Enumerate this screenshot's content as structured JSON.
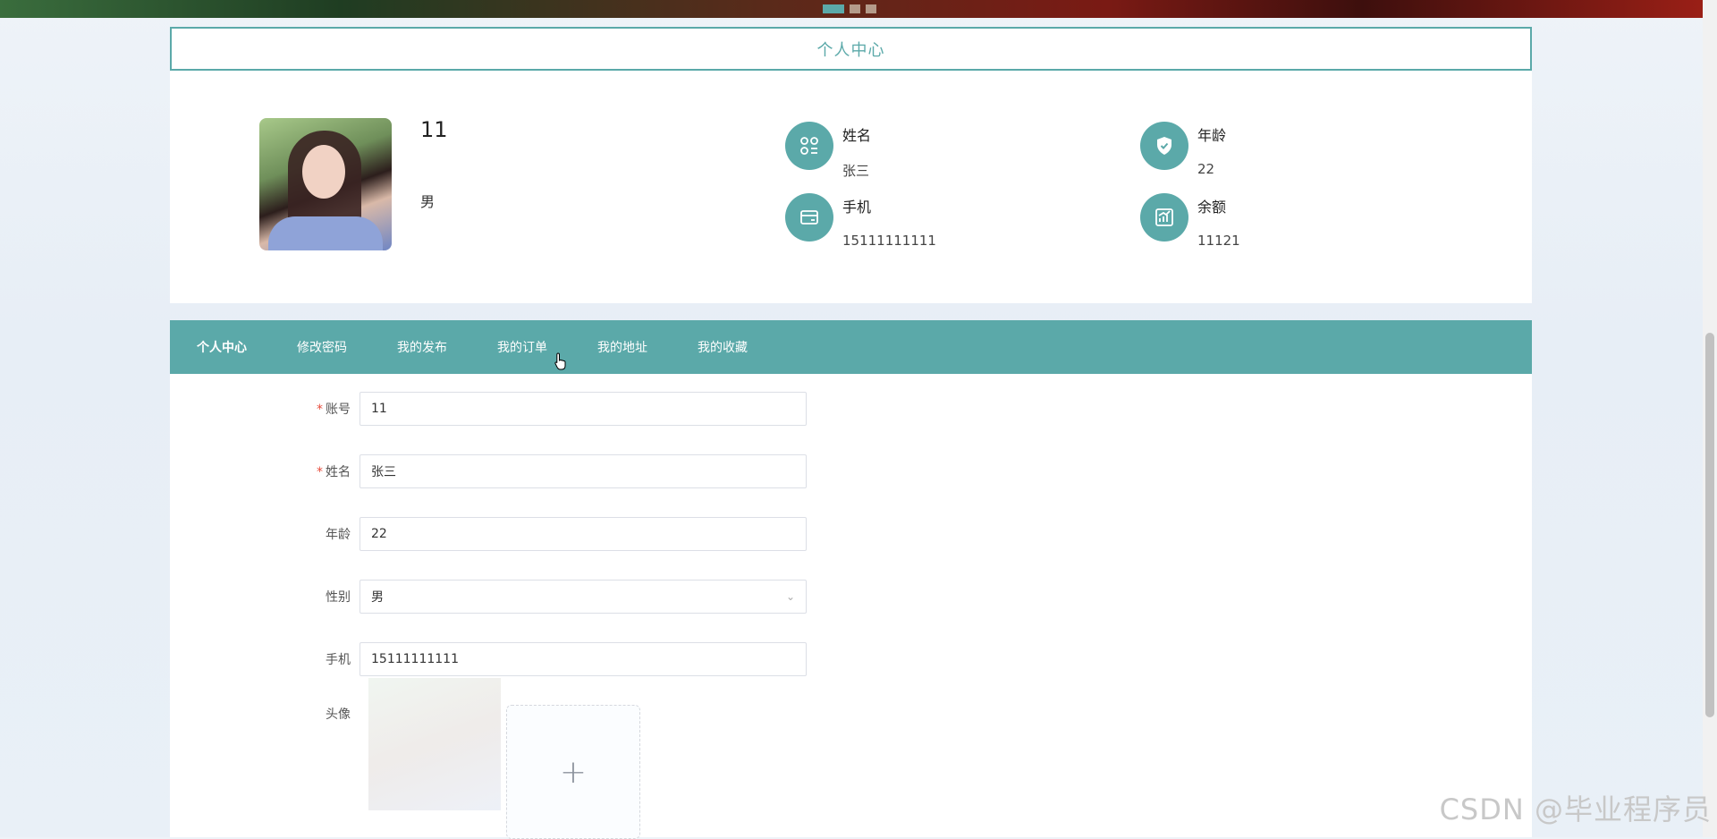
{
  "banner": {
    "slides": 3,
    "active_slide": 1
  },
  "page": {
    "title": "个人中心"
  },
  "profile": {
    "username": "11",
    "gender": "男",
    "fields": [
      {
        "label": "姓名",
        "value": "张三",
        "icon": "user-grid-icon"
      },
      {
        "label": "年龄",
        "value": "22",
        "icon": "shield-check-icon"
      },
      {
        "label": "手机",
        "value": "15111111111",
        "icon": "wallet-icon"
      },
      {
        "label": "余额",
        "value": "11121",
        "icon": "chart-icon"
      }
    ]
  },
  "tabs": [
    {
      "label": "个人中心"
    },
    {
      "label": "修改密码"
    },
    {
      "label": "我的发布"
    },
    {
      "label": "我的订单"
    },
    {
      "label": "我的地址"
    },
    {
      "label": "我的收藏"
    }
  ],
  "form": {
    "account": {
      "label": "账号",
      "value": "11",
      "required": true
    },
    "name": {
      "label": "姓名",
      "value": "张三",
      "required": true
    },
    "age": {
      "label": "年龄",
      "value": "22"
    },
    "gender": {
      "label": "性别",
      "value": "男"
    },
    "phone": {
      "label": "手机",
      "value": "15111111111"
    },
    "avatar": {
      "label": "头像",
      "upload_symbol": "+"
    }
  },
  "watermark": "CSDN @毕业程序员",
  "colors": {
    "accent": "#5ba9a9",
    "required": "#e74c3c"
  }
}
